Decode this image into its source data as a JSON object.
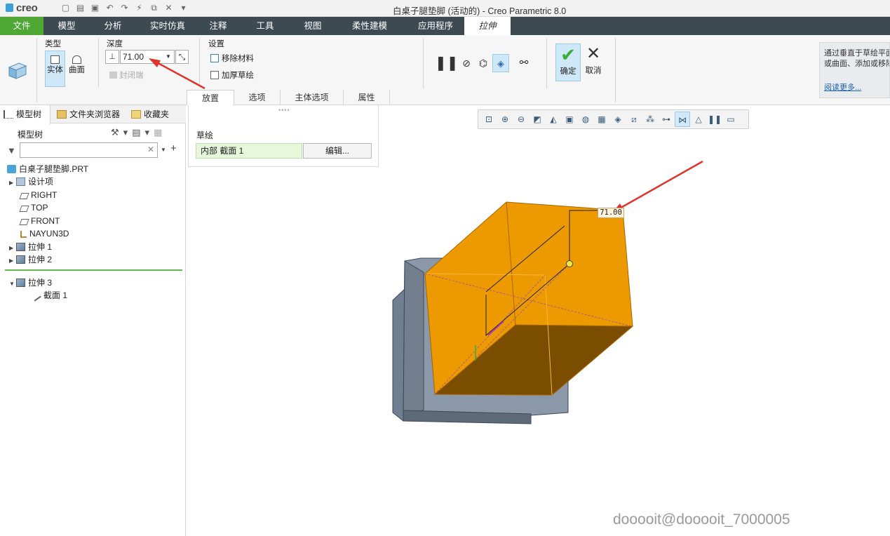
{
  "app": {
    "logo_text": "creo",
    "window_title": "白桌子腿垫脚 (活动的) - Creo Parametric 8.0",
    "qat_icons": [
      "new-icon",
      "open-icon",
      "save-icon",
      "undo-icon",
      "redo-icon",
      "regenerate-icon",
      "windows-icon",
      "close-window-icon",
      "customize-icon"
    ]
  },
  "menu": {
    "tabs": [
      {
        "label": "文件",
        "kind": "file"
      },
      {
        "label": "模型"
      },
      {
        "label": "分析"
      },
      {
        "label": "实时仿真"
      },
      {
        "label": "注释"
      },
      {
        "label": "工具"
      },
      {
        "label": "视图"
      },
      {
        "label": "柔性建模"
      },
      {
        "label": "应用程序"
      },
      {
        "label": "拉伸",
        "kind": "active"
      }
    ]
  },
  "ribbon": {
    "type_label": "类型",
    "solid_label": "实体",
    "surface_label": "曲面",
    "depth_label": "深度",
    "depth_value": "71.00",
    "close_end_label": "封闭端",
    "settings_label": "设置",
    "remove_material_label": "移除材料",
    "thicken_sketch_label": "加厚草绘",
    "subtabs": [
      "放置",
      "选项",
      "主体选项",
      "属性"
    ],
    "ok_label": "确定",
    "cancel_label": "取消",
    "help_text_1": "通过垂直于草绘平面",
    "help_text_2": "或曲面、添加或移除",
    "help_more": "阅读更多..."
  },
  "left_panel": {
    "tabs": [
      "模型树",
      "文件夹浏览器",
      "收藏夹"
    ],
    "tree_title": "模型树",
    "search_placeholder": "",
    "items": [
      {
        "label": "白桌子腿垫脚.PRT",
        "icon": "part-icon"
      },
      {
        "label": "设计项",
        "icon": "design-items-icon"
      },
      {
        "label": "RIGHT",
        "icon": "datum-plane-icon"
      },
      {
        "label": "TOP",
        "icon": "datum-plane-icon"
      },
      {
        "label": "FRONT",
        "icon": "datum-plane-icon"
      },
      {
        "label": "NAYUN3D",
        "icon": "csys-icon"
      },
      {
        "label": "拉伸 1",
        "icon": "extrude-feature-icon"
      },
      {
        "label": "拉伸 2",
        "icon": "extrude-feature-icon"
      },
      {
        "label": "拉伸 3",
        "icon": "extrude-feature-icon"
      },
      {
        "label": "截面 1",
        "icon": "sketch-icon"
      }
    ]
  },
  "placement_panel": {
    "sketch_label": "草绘",
    "sketch_value": "内部 截面 1",
    "edit_label": "编辑..."
  },
  "graphics": {
    "dimension_label": "71.00",
    "watermark": "dooooit@dooooit_7000005",
    "view_tools": [
      "refit-icon",
      "zoom-in-icon",
      "zoom-out-icon",
      "repaint-icon",
      "display-style-icon",
      "saved-views-icon",
      "view-manager-icon",
      "perspective-icon",
      "section-icon",
      "datum-display-icon",
      "annotation-display-icon",
      "spin-center-icon",
      "point-display-icon",
      "csys-display-icon",
      "pause-icon",
      "tag-display-icon"
    ],
    "colors": {
      "extrude_preview": "#ec9a00",
      "base_part": "#8a97a8",
      "arrow": "#e1322b"
    }
  }
}
